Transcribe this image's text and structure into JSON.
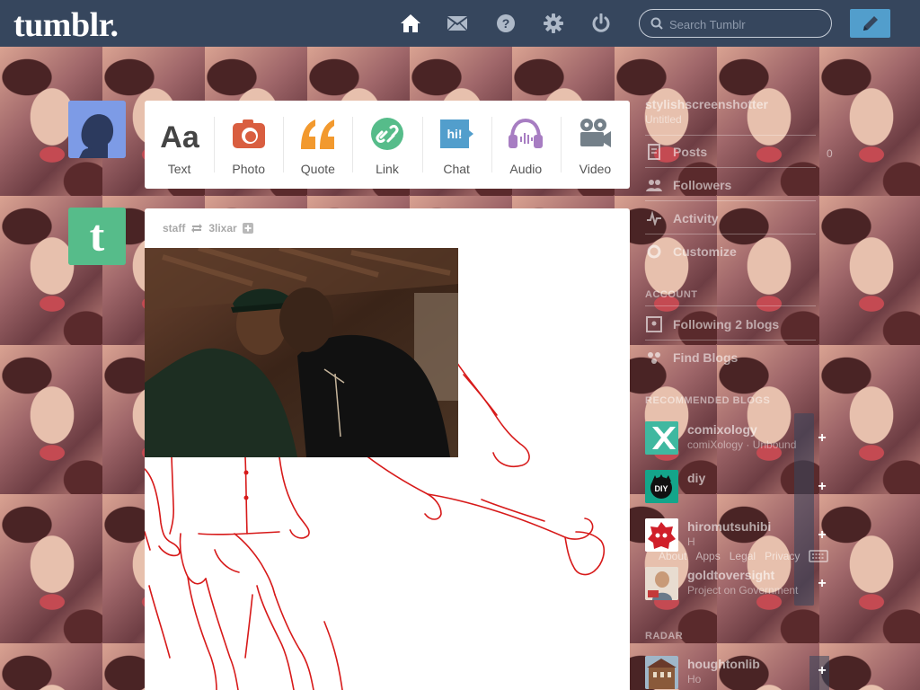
{
  "topbar": {
    "logo": "tumblr.",
    "nav": [
      {
        "name": "home-icon",
        "label": "Dashboard"
      },
      {
        "name": "mail-icon",
        "label": "Messages"
      },
      {
        "name": "help-icon",
        "label": "Help"
      },
      {
        "name": "gear-icon",
        "label": "Settings"
      },
      {
        "name": "power-icon",
        "label": "Log out"
      }
    ],
    "search_placeholder": "Search Tumblr",
    "compose_icon": "pencil-icon"
  },
  "post_types": [
    {
      "label": "Text",
      "icon": "text-icon",
      "color": "#444444"
    },
    {
      "label": "Photo",
      "icon": "camera-icon",
      "color": "#d95e40"
    },
    {
      "label": "Quote",
      "icon": "quote-icon",
      "color": "#f2992e"
    },
    {
      "label": "Link",
      "icon": "link-icon",
      "color": "#56bc8a"
    },
    {
      "label": "Chat",
      "icon": "chat-icon",
      "color": "#529ecc"
    },
    {
      "label": "Audio",
      "icon": "headphones-icon",
      "color": "#a77dc2"
    },
    {
      "label": "Video",
      "icon": "video-camera-icon",
      "color": "#748089"
    }
  ],
  "post": {
    "author": "staff",
    "reblog_icon": "reblog-icon",
    "reblogged_from": "3lixar",
    "follow_icon": "plus-icon"
  },
  "sidebar": {
    "blog_title": "stylishscreenshotter",
    "blog_subtitle": "Untitled",
    "items": [
      {
        "label": "Posts",
        "icon": "posts-icon"
      },
      {
        "label": "Followers",
        "icon": "followers-icon"
      },
      {
        "label": "Activity",
        "icon": "activity-icon"
      },
      {
        "label": "Customize",
        "icon": "customize-icon"
      }
    ],
    "posts_count": "0",
    "account_heading": "ACCOUNT",
    "account_items": [
      {
        "label": "Following 2 blogs",
        "icon": "following-icon"
      },
      {
        "label": "Find Blogs",
        "icon": "find-blogs-icon"
      }
    ],
    "recommended_heading": "RECOMMENDED BLOGS",
    "recommended": [
      {
        "name": "comixology",
        "sub": "comiXology · Unbound",
        "color": "#3fb8a0"
      },
      {
        "name": "diy",
        "sub": "",
        "color": "#14a58a"
      },
      {
        "name": "hiromutsuhibi",
        "sub": "H",
        "color": "#d01f2a"
      },
      {
        "name": "goldtoversight",
        "sub": "Project on Government",
        "color": "#e8dcd0"
      }
    ],
    "footer_links": [
      "About",
      "Apps",
      "Legal",
      "Privacy"
    ],
    "bottom_heading": "RADAR",
    "radar": {
      "name": "houghtonlib",
      "sub": "Ho",
      "color": "#7a6a5a"
    }
  }
}
